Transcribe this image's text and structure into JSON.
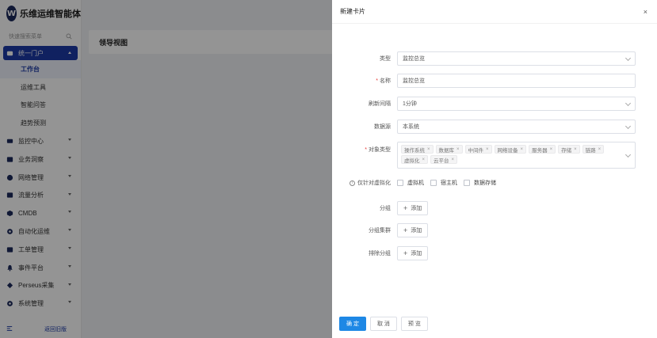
{
  "app": {
    "logo_letter": "W",
    "title": "乐维运维智能体"
  },
  "sidebar": {
    "search_placeholder": "快速搜索菜单",
    "open_group": "统一门户",
    "sub_items": [
      "工作台",
      "运维工具",
      "智能问答",
      "趋势预测"
    ],
    "groups": [
      "监控中心",
      "业务洞察",
      "网络管理",
      "流量分析",
      "CMDB",
      "自动化运维",
      "工单管理",
      "事件平台",
      "Perseus采集",
      "系统管理"
    ],
    "footer_link": "返回旧版"
  },
  "main": {
    "title": "领导视图"
  },
  "drawer": {
    "title": "新建卡片",
    "close": "×",
    "fields": {
      "type_label": "类型",
      "type_value": "监控总览",
      "name_label": "名称",
      "name_value": "监控总览",
      "interval_label": "刷新间隔",
      "interval_value": "1分钟",
      "source_label": "数据源",
      "source_value": "本系统",
      "objtype_label": "对象类型",
      "objtypes": [
        "操作系统",
        "数据库",
        "中间件",
        "网络设备",
        "服务器",
        "存储",
        "链路",
        "虚拟化",
        "云平台"
      ],
      "virt_label": "仅针对虚拟化",
      "virt_options": [
        "虚拟机",
        "宿主机",
        "数据存储"
      ],
      "group_label": "分组",
      "cluster_label": "分组集群",
      "exclude_label": "排除分组",
      "add_label": "添加"
    },
    "buttons": {
      "ok": "确 定",
      "cancel": "取 消",
      "preview": "预 览"
    }
  },
  "colors": {
    "brand": "#1c3aa6",
    "primary_button": "#1e88e5",
    "required": "#e53935"
  }
}
